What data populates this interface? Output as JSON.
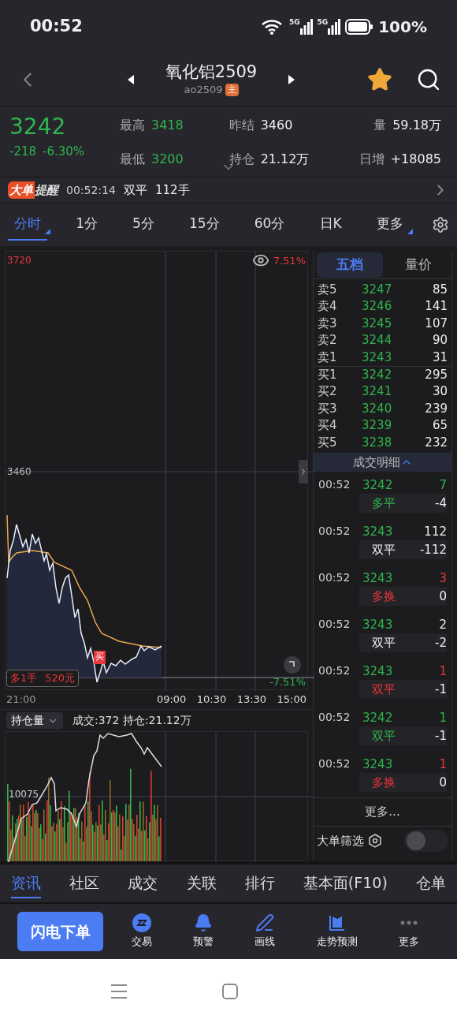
{
  "status_bar": {
    "time": "00:52",
    "networks": [
      "5G",
      "5G"
    ],
    "battery": "100%"
  },
  "header": {
    "title": "氧化铝2509",
    "code": "ao2509",
    "badge": "主",
    "favorite": true
  },
  "quote": {
    "price": "3242",
    "change": "-218",
    "change_pct": "-6.30%",
    "stats": [
      {
        "label": "最高",
        "value": "3418",
        "color": "#2fb54d"
      },
      {
        "label": "昨结",
        "value": "3460",
        "color": "#eeeeee"
      },
      {
        "label": "量",
        "value": "59.18万",
        "color": "#eeeeee"
      },
      {
        "label": "最低",
        "value": "3200",
        "color": "#2fb54d"
      },
      {
        "label": "持仓",
        "value": "21.12万",
        "color": "#eeeeee"
      },
      {
        "label": "日增",
        "value": "+18085",
        "color": "#eeeeee"
      }
    ]
  },
  "alert": {
    "tag_1": "大单",
    "tag_2": "提醒",
    "time": "00:52:14",
    "action": "双平",
    "volume": "112手"
  },
  "periods": [
    {
      "label": "分时",
      "selected": true,
      "dropdown": true
    },
    {
      "label": "1分",
      "selected": false,
      "dropdown": false
    },
    {
      "label": "5分",
      "selected": false,
      "dropdown": false
    },
    {
      "label": "15分",
      "selected": false,
      "dropdown": false
    },
    {
      "label": "60分",
      "selected": false,
      "dropdown": false
    },
    {
      "label": "日K",
      "selected": false,
      "dropdown": false
    },
    {
      "label": "更多",
      "selected": false,
      "dropdown": true
    }
  ],
  "chart": {
    "price_high": "3720",
    "price_mid": "3460",
    "pct_high": "7.51%",
    "pct_low": "-7.51%",
    "buy_marker": "买",
    "position": "多1手",
    "position_pnl": "520元",
    "times": [
      "21:00",
      "09:00",
      "10:30",
      "13:30",
      "15:00"
    ]
  },
  "sub_chart": {
    "indicator": "持仓量",
    "summary": "成交:372 持仓:21.12万",
    "level_label": "10075"
  },
  "book_tabs": [
    {
      "label": "五档",
      "selected": true
    },
    {
      "label": "量价",
      "selected": false
    }
  ],
  "book": [
    {
      "label": "卖5",
      "price": "3247",
      "volume": "85"
    },
    {
      "label": "卖4",
      "price": "3246",
      "volume": "141"
    },
    {
      "label": "卖3",
      "price": "3245",
      "volume": "107"
    },
    {
      "label": "卖2",
      "price": "3244",
      "volume": "90"
    },
    {
      "label": "卖1",
      "price": "3243",
      "volume": "31"
    },
    {
      "label": "买1",
      "price": "3242",
      "volume": "295"
    },
    {
      "label": "买2",
      "price": "3241",
      "volume": "30"
    },
    {
      "label": "买3",
      "price": "3240",
      "volume": "239"
    },
    {
      "label": "买4",
      "price": "3239",
      "volume": "65"
    },
    {
      "label": "买5",
      "price": "3238",
      "volume": "232"
    }
  ],
  "trades_title": "成交明细",
  "trades": [
    {
      "time": "00:52",
      "price": "3242",
      "volume": {
        "value": "7",
        "color": "#2fb54d"
      },
      "type": {
        "label": "多平",
        "color": "#2fb54d"
      },
      "change": "-4"
    },
    {
      "time": "00:52",
      "price": "3243",
      "volume": {
        "value": "112",
        "color": "#eeeeee"
      },
      "type": {
        "label": "双平",
        "color": "#eeeeee"
      },
      "change": "-112"
    },
    {
      "time": "00:52",
      "price": "3243",
      "volume": {
        "value": "3",
        "color": "#e8373a"
      },
      "type": {
        "label": "多换",
        "color": "#e8373a"
      },
      "change": "0"
    },
    {
      "time": "00:52",
      "price": "3243",
      "volume": {
        "value": "2",
        "color": "#eeeeee"
      },
      "type": {
        "label": "双平",
        "color": "#eeeeee"
      },
      "change": "-2"
    },
    {
      "time": "00:52",
      "price": "3243",
      "volume": {
        "value": "1",
        "color": "#e8373a"
      },
      "type": {
        "label": "双平",
        "color": "#e8373a"
      },
      "change": "-1"
    },
    {
      "time": "00:52",
      "price": "3242",
      "volume": {
        "value": "1",
        "color": "#2fb54d"
      },
      "type": {
        "label": "双平",
        "color": "#2fb54d"
      },
      "change": "-1"
    },
    {
      "time": "00:52",
      "price": "3243",
      "volume": {
        "value": "1",
        "color": "#e8373a"
      },
      "type": {
        "label": "多换",
        "color": "#e8373a"
      },
      "change": "0"
    }
  ],
  "more": "更多...",
  "filter": {
    "label": "大单筛选",
    "on": false
  },
  "bottom_tabs": [
    {
      "label": "资讯",
      "selected": true
    },
    {
      "label": "社区",
      "selected": false
    },
    {
      "label": "成交",
      "selected": false
    },
    {
      "label": "关联",
      "selected": false
    },
    {
      "label": "排行",
      "selected": false
    },
    {
      "label": "基本面(F10)",
      "selected": false
    },
    {
      "label": "仓单",
      "selected": false
    }
  ],
  "toolbar": {
    "primary": "闪电下单",
    "actions": [
      {
        "kind": "trade",
        "label": "交易"
      },
      {
        "kind": "alert",
        "label": "预警"
      },
      {
        "kind": "draw",
        "label": "画线"
      },
      {
        "kind": "forecast",
        "label": "走势预测"
      },
      {
        "kind": "more",
        "label": "更多"
      }
    ]
  }
}
